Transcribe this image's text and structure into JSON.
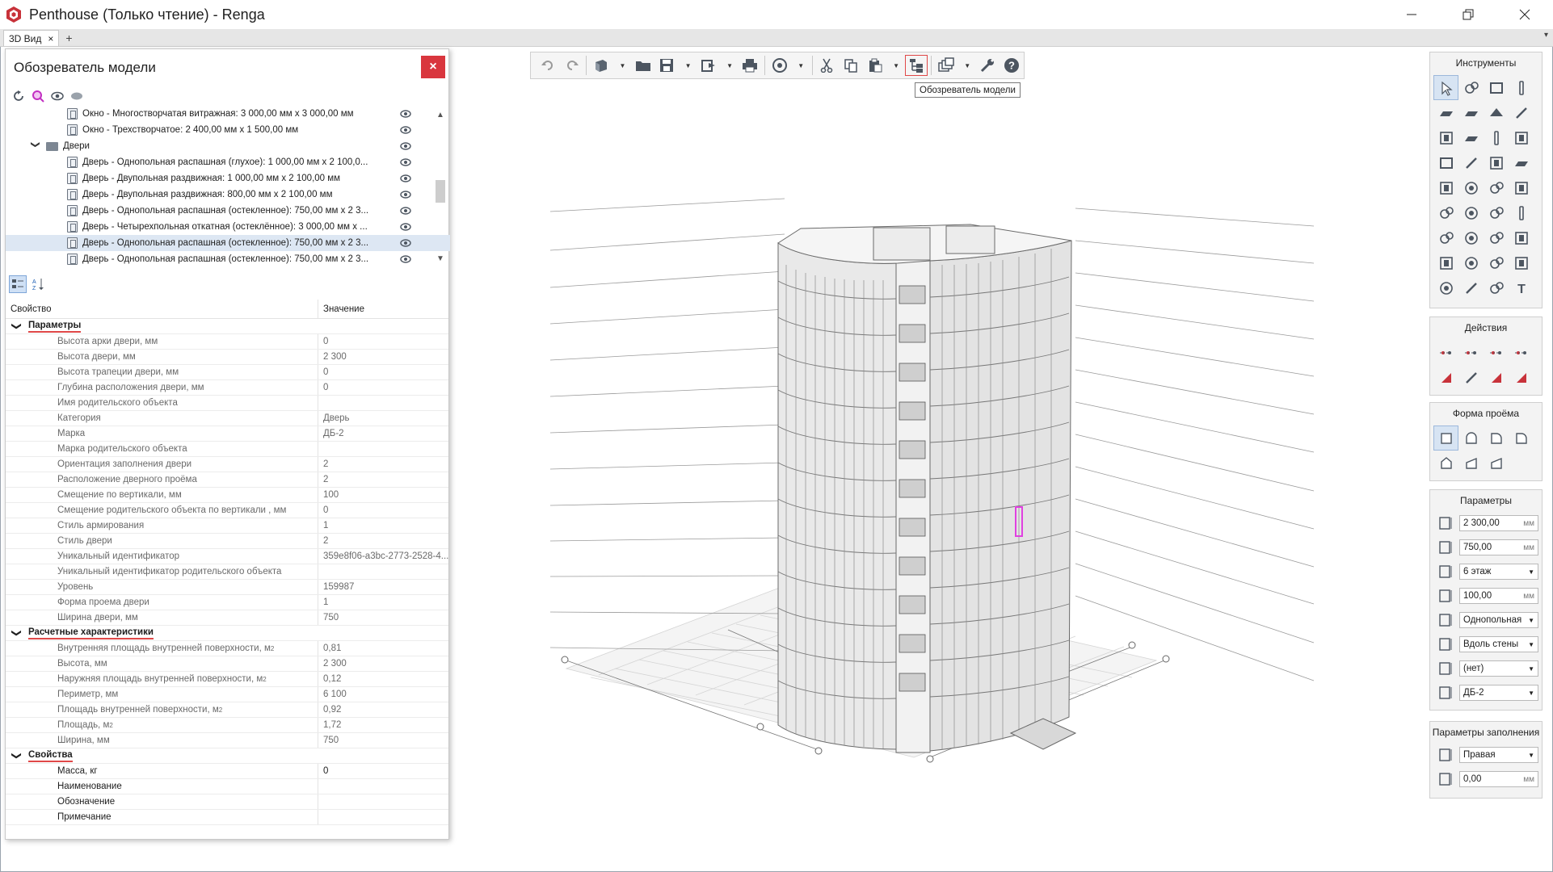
{
  "window": {
    "title": "Penthouse (Только чтение) - Renga",
    "tab_label": "3D Вид",
    "tab_close": "×",
    "tab_add": "+",
    "tab_menu": "▾"
  },
  "explorer": {
    "title": "Обозреватель модели",
    "close": "×",
    "tree": [
      {
        "type": "item",
        "label": "Окно - Многостворчатая витражная: 3 000,00 мм x 3 000,00 мм",
        "selected": false
      },
      {
        "type": "item",
        "label": "Окно - Трехстворчатое: 2 400,00 мм x 1 500,00 мм",
        "selected": false
      },
      {
        "type": "folder",
        "label": "Двери",
        "selected": false
      },
      {
        "type": "item",
        "label": "Дверь - Однопольная распашная (глухое): 1 000,00 мм x 2 100,0...",
        "selected": false
      },
      {
        "type": "item",
        "label": "Дверь - Двупольная раздвижная: 1 000,00 мм x 2 100,00 мм",
        "selected": false
      },
      {
        "type": "item",
        "label": "Дверь - Двупольная раздвижная: 800,00 мм x 2 100,00 мм",
        "selected": false
      },
      {
        "type": "item",
        "label": "Дверь - Однопольная распашная (остекленное): 750,00 мм x 2 3...",
        "selected": false
      },
      {
        "type": "item",
        "label": "Дверь - Четырехпольная откатная (остеклённое): 3 000,00 мм x ...",
        "selected": false
      },
      {
        "type": "item",
        "label": "Дверь - Однопольная распашная (остекленное): 750,00 мм x 2 3...",
        "selected": true
      },
      {
        "type": "item",
        "label": "Дверь - Однопольная распашная (остекленное): 750,00 мм x 2 3...",
        "selected": false
      }
    ],
    "columns": {
      "name": "Свойство",
      "value": "Значение"
    },
    "groups": [
      {
        "name": "Параметры",
        "rows": [
          {
            "name": "Высота арки двери, мм",
            "value": "0"
          },
          {
            "name": "Высота двери, мм",
            "value": "2 300"
          },
          {
            "name": "Высота трапеции двери, мм",
            "value": "0"
          },
          {
            "name": "Глубина расположения двери, мм",
            "value": "0"
          },
          {
            "name": "Имя родительского объекта",
            "value": ""
          },
          {
            "name": "Категория",
            "value": "Дверь"
          },
          {
            "name": "Марка",
            "value": "ДБ-2"
          },
          {
            "name": "Марка родительского объекта",
            "value": ""
          },
          {
            "name": "Ориентация заполнения двери",
            "value": "2"
          },
          {
            "name": "Расположение дверного проёма",
            "value": "2"
          },
          {
            "name": "Смещение по вертикали, мм",
            "value": "100"
          },
          {
            "name": "Смещение родительского объекта по вертикали , мм",
            "value": "0"
          },
          {
            "name": "Стиль армирования",
            "value": "1"
          },
          {
            "name": "Стиль двери",
            "value": "2"
          },
          {
            "name": "Уникальный идентификатор",
            "value": "359e8f06-a3bc-2773-2528-4..."
          },
          {
            "name": "Уникальный идентификатор родительского объекта",
            "value": ""
          },
          {
            "name": "Уровень",
            "value": "159987"
          },
          {
            "name": "Форма проема двери",
            "value": "1"
          },
          {
            "name": "Ширина двери, мм",
            "value": "750"
          }
        ]
      },
      {
        "name": "Расчетные характеристики",
        "rows": [
          {
            "name": "Внутренняя площадь внутренней поверхности, м²",
            "value": "0,81"
          },
          {
            "name": "Высота, мм",
            "value": "2 300"
          },
          {
            "name": "Наружняя площадь внутренней поверхности, м²",
            "value": "0,12"
          },
          {
            "name": "Периметр, мм",
            "value": "6 100"
          },
          {
            "name": "Площадь внутренней поверхности, м²",
            "value": "0,92"
          },
          {
            "name": "Площадь, м²",
            "value": "1,72"
          },
          {
            "name": "Ширина, мм",
            "value": "750"
          }
        ]
      },
      {
        "name": "Свойства",
        "rows": [
          {
            "name": "Масса, кг",
            "value": "0"
          },
          {
            "name": "Наименование",
            "value": ""
          },
          {
            "name": "Обозначение",
            "value": ""
          },
          {
            "name": "Примечание",
            "value": ""
          }
        ]
      }
    ]
  },
  "toolbar": {
    "tooltip": "Обозреватель модели"
  },
  "panels": {
    "tools_title": "Инструменты",
    "actions_title": "Действия",
    "opening_title": "Форма проёма",
    "params_title": "Параметры",
    "fill_title": "Параметры заполнения",
    "params": [
      {
        "value": "2 300,00",
        "unit": "мм",
        "dropdown": false
      },
      {
        "value": "750,00",
        "unit": "мм",
        "dropdown": false
      },
      {
        "value": "6 этаж",
        "unit": "",
        "dropdown": true
      },
      {
        "value": "100,00",
        "unit": "мм",
        "dropdown": false
      },
      {
        "value": "Однопольная",
        "unit": "",
        "dropdown": true
      },
      {
        "value": "Вдоль стены",
        "unit": "",
        "dropdown": true
      },
      {
        "value": "(нет)",
        "unit": "",
        "dropdown": true
      },
      {
        "value": "ДБ-2",
        "unit": "",
        "dropdown": true
      }
    ],
    "fill_params": [
      {
        "value": "Правая",
        "unit": "",
        "dropdown": true
      },
      {
        "value": "0,00",
        "unit": "мм",
        "dropdown": false
      }
    ]
  },
  "colors": {
    "accent_red": "#d9363e",
    "selection": "#dde7f3",
    "group_underline": "#e04848"
  }
}
